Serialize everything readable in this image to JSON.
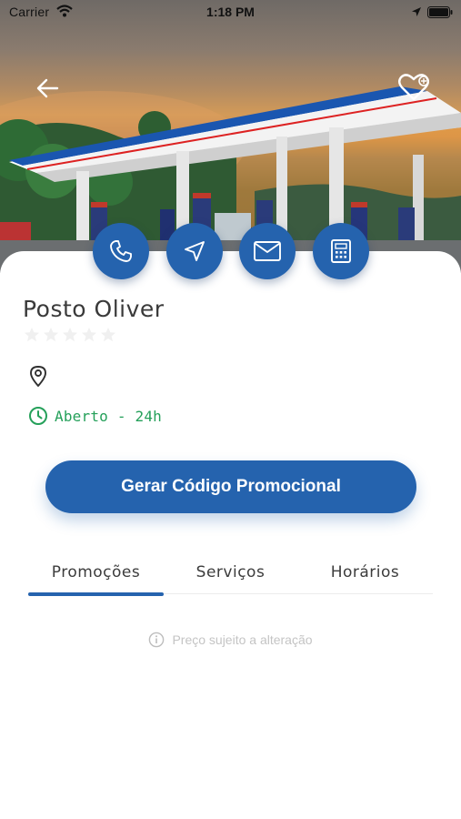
{
  "status_bar": {
    "carrier": "Carrier",
    "time": "1:18 PM"
  },
  "header": {
    "back_icon": "arrow-left-icon",
    "favorite_icon": "heart-icon"
  },
  "actions": [
    {
      "icon": "phone-icon"
    },
    {
      "icon": "navigation-icon"
    },
    {
      "icon": "mail-icon"
    },
    {
      "icon": "calculator-icon"
    }
  ],
  "station": {
    "name": "Posto Oliver",
    "rating": 0,
    "rating_max": 5,
    "address": "",
    "hours": "Aberto - 24h"
  },
  "promo_button": {
    "label": "Gerar Código Promocional"
  },
  "tabs": [
    {
      "label": "Promoções",
      "active": true
    },
    {
      "label": "Serviços",
      "active": false
    },
    {
      "label": "Horários",
      "active": false
    }
  ],
  "notice": {
    "text": "Preço sujeito a alteração"
  },
  "colors": {
    "primary": "#2563ae",
    "open_status": "#25a05a",
    "muted_text": "#c4c4c4"
  }
}
